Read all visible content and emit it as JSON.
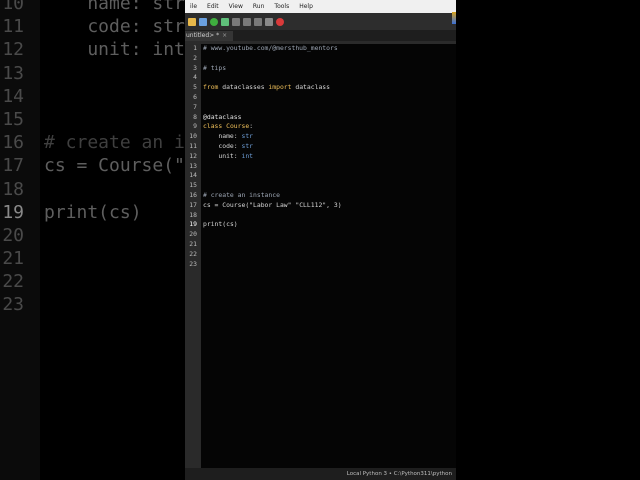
{
  "menu": [
    "ile",
    "Edit",
    "View",
    "Run",
    "Tools",
    "Help"
  ],
  "tab": {
    "label": "untitled> *",
    "close": "×"
  },
  "editor": {
    "current_line": 19,
    "lines": [
      [
        {
          "t": "# www.youtube.com/@mersthub_mentors",
          "c": "cm"
        }
      ],
      [],
      [
        {
          "t": "# tips",
          "c": "cm"
        }
      ],
      [],
      [
        {
          "t": "from",
          "c": "kw"
        },
        {
          "t": " dataclasses ",
          "c": ""
        },
        {
          "t": "import",
          "c": "kw"
        },
        {
          "t": " dataclass",
          "c": ""
        }
      ],
      [],
      [],
      [
        {
          "t": "@dataclass",
          "c": "deco"
        }
      ],
      [
        {
          "t": "class",
          "c": "kw"
        },
        {
          "t": " ",
          "c": ""
        },
        {
          "t": "Course",
          "c": "cls"
        },
        {
          "t": ":",
          "c": ""
        }
      ],
      [
        {
          "t": "    name: ",
          "c": ""
        },
        {
          "t": "str",
          "c": "typ"
        }
      ],
      [
        {
          "t": "    code: ",
          "c": ""
        },
        {
          "t": "str",
          "c": "typ"
        }
      ],
      [
        {
          "t": "    unit: ",
          "c": ""
        },
        {
          "t": "int",
          "c": "typ"
        }
      ],
      [],
      [],
      [],
      [
        {
          "t": "# create an instance",
          "c": "cm"
        }
      ],
      [
        {
          "t": "cs = Course(",
          "c": ""
        },
        {
          "t": "\"Labor Law\"",
          "c": "str"
        },
        {
          "t": " ",
          "c": ""
        },
        {
          "t": "\"CLL112\"",
          "c": "str"
        },
        {
          "t": ", ",
          "c": ""
        },
        {
          "t": "3",
          "c": "num"
        },
        {
          "t": ")",
          "c": ""
        }
      ],
      [],
      [
        {
          "t": "print",
          "c": ""
        },
        {
          "t": "(cs)",
          "c": ""
        }
      ],
      [],
      [],
      [],
      []
    ]
  },
  "background_zoom": {
    "lines": [
      {
        "n": "10",
        "t": "    name: str"
      },
      {
        "n": "11",
        "t": "    code: str"
      },
      {
        "n": "12",
        "t": "    unit: int"
      },
      {
        "n": "13",
        "t": ""
      },
      {
        "n": "14",
        "t": ""
      },
      {
        "n": "15",
        "t": ""
      },
      {
        "n": "16",
        "t": "# create an i"
      },
      {
        "n": "17",
        "t": "cs = Course(\""
      },
      {
        "n": "18",
        "t": ""
      },
      {
        "n": "19",
        "t": "print(cs)"
      },
      {
        "n": "20",
        "t": ""
      },
      {
        "n": "21",
        "t": ""
      },
      {
        "n": "22",
        "t": ""
      },
      {
        "n": "23",
        "t": ""
      }
    ]
  },
  "status": {
    "interpreter": "Local Python 3 • C:\\Python311\\python"
  },
  "colors": {
    "run": "#3fae3f",
    "stop": "#d93a3a",
    "save": "#6aa0e0",
    "new": "#e8b84a"
  }
}
